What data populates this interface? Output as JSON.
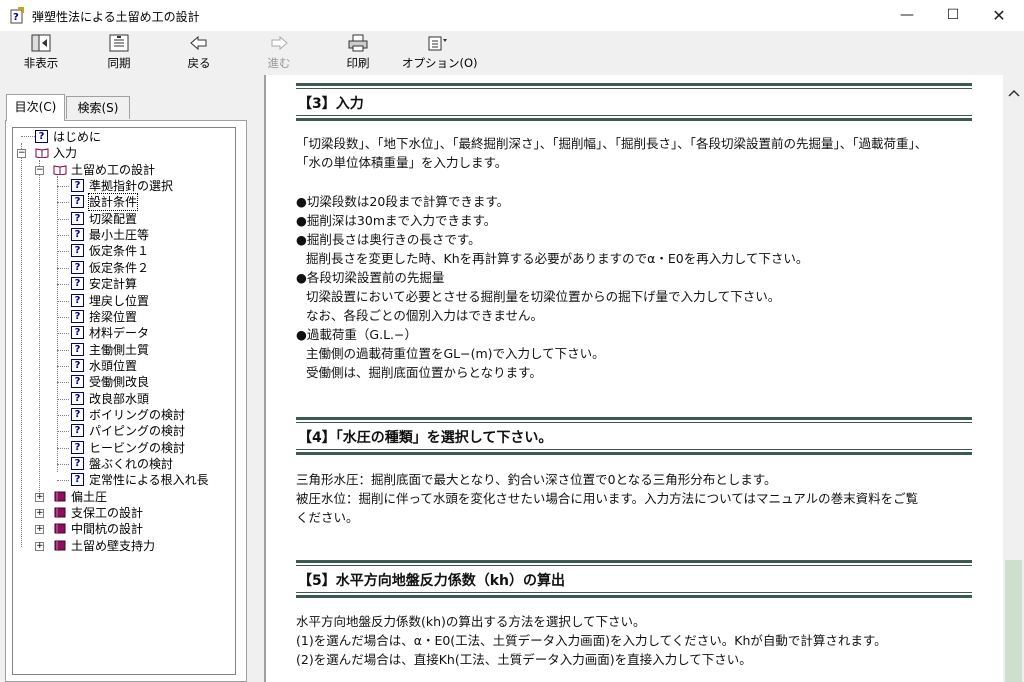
{
  "window": {
    "title": "弾塑性法による土留め工の設計",
    "minimize": "—",
    "maximize": "☐",
    "close": "✕"
  },
  "toolbar": {
    "hide": "非表示",
    "sync": "同期",
    "back": "戻る",
    "forward": "進む",
    "print": "印刷",
    "options": "オプション(O)"
  },
  "tabs": {
    "toc": "目次(C)",
    "search": "検索(S)"
  },
  "tree": [
    {
      "label": "はじめに",
      "icon": "help-page-icon"
    },
    {
      "label": "入力",
      "icon": "open-book-icon",
      "expander": "−"
    },
    {
      "label": "土留め工の設計",
      "icon": "open-book-icon",
      "expander": "−"
    },
    {
      "label": "準拠指針の選択",
      "icon": "help-page-icon"
    },
    {
      "label": "設計条件",
      "icon": "help-page-icon",
      "selected": true
    },
    {
      "label": "切梁配置",
      "icon": "help-page-icon"
    },
    {
      "label": "最小土圧等",
      "icon": "help-page-icon"
    },
    {
      "label": "仮定条件１",
      "icon": "help-page-icon"
    },
    {
      "label": "仮定条件２",
      "icon": "help-page-icon"
    },
    {
      "label": "安定計算",
      "icon": "help-page-icon"
    },
    {
      "label": "埋戻し位置",
      "icon": "help-page-icon"
    },
    {
      "label": "捨梁位置",
      "icon": "help-page-icon"
    },
    {
      "label": "材料データ",
      "icon": "help-page-icon"
    },
    {
      "label": "主働側土質",
      "icon": "help-page-icon"
    },
    {
      "label": "水頭位置",
      "icon": "help-page-icon"
    },
    {
      "label": "受働側改良",
      "icon": "help-page-icon"
    },
    {
      "label": "改良部水頭",
      "icon": "help-page-icon"
    },
    {
      "label": "ボイリングの検討",
      "icon": "help-page-icon"
    },
    {
      "label": "パイピングの検討",
      "icon": "help-page-icon"
    },
    {
      "label": "ヒービングの検討",
      "icon": "help-page-icon"
    },
    {
      "label": "盤ぶくれの検討",
      "icon": "help-page-icon"
    },
    {
      "label": "定常性による根入れ長",
      "icon": "help-page-icon"
    },
    {
      "label": "偏土圧",
      "icon": "closed-book-icon",
      "expander": "+"
    },
    {
      "label": "支保工の設計",
      "icon": "closed-book-icon",
      "expander": "+"
    },
    {
      "label": "中間杭の設計",
      "icon": "closed-book-icon",
      "expander": "+"
    },
    {
      "label": "土留め壁支持力",
      "icon": "closed-book-icon",
      "expander": "+"
    }
  ],
  "content": {
    "sec3": {
      "title": "【3】入力",
      "intro1": "「切梁段数」、「地下水位」、「最終掘削深さ」、「掘削幅」、「掘削長さ」、「各段切梁設置前の先掘量」、「過載荷重」、",
      "intro2": "「水の単位体積重量」を入力します。",
      "b1": "●切梁段数は20段まで計算できます。",
      "b2": "●掘削深は30mまで入力できます。",
      "b3": "●掘削長さは奥行きの長さです。",
      "b3a": "掘削長さを変更した時、Khを再計算する必要がありますのでα・E0を再入力して下さい。",
      "b4": "●各段切梁設置前の先掘量",
      "b4a": "切梁設置において必要とさせる掘削量を切梁位置からの掘下げ量で入力して下さい。",
      "b4b": "なお、各段ごとの個別入力はできません。",
      "b5": "●過載荷重（G.L.−）",
      "b5a": "主働側の過載荷重位置をGL−(m)で入力して下さい。",
      "b5b": "受働側は、掘削底面位置からとなります。"
    },
    "sec4": {
      "title": "【4】「水圧の種類」を選択して下さい。",
      "p1": "三角形水圧：掘削底面で最大となり、釣合い深さ位置で0となる三角形分布とします。",
      "p2": "被圧水位：掘削に伴って水頭を変化させたい場合に用います。入力方法についてはマニュアルの巻末資料をご覧",
      "p3": "ください。"
    },
    "sec5": {
      "title": "【5】水平方向地盤反力係数（kh）の算出",
      "p1": "水平方向地盤反力係数(kh)の算出する方法を選択して下さい。",
      "p2": "(1)を選んだ場合は、α・E0(工法、土質データ入力画面)を入力してください。Khが自動で計算されます。",
      "p3": "(2)を選んだ場合は、直接Kh(工法、土質データ入力画面)を直接入力して下さい。"
    }
  },
  "colors": {
    "rule": "#3b5a52",
    "scroll_thumb": "#cddfcd"
  }
}
